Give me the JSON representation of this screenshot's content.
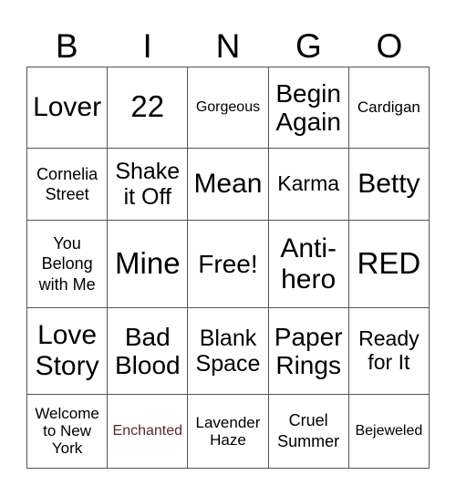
{
  "header": [
    "B",
    "I",
    "N",
    "G",
    "O"
  ],
  "cell_color_special": "#5a2a2a",
  "rows": [
    [
      "Lover",
      "22",
      "Gorgeous",
      "Begin Again",
      "Cardigan"
    ],
    [
      "Cornelia Street",
      "Shake it Off",
      "Mean",
      "Karma",
      "Betty"
    ],
    [
      "You Belong with Me",
      "Mine",
      "Free!",
      "Anti-hero",
      "RED"
    ],
    [
      "Love Story",
      "Bad Blood",
      "Blank Space",
      "Paper Rings",
      "Ready for It"
    ],
    [
      "Welcome to New York",
      "Enchanted",
      "Lavender Haze",
      "Cruel Summer",
      "Bejeweled"
    ]
  ]
}
